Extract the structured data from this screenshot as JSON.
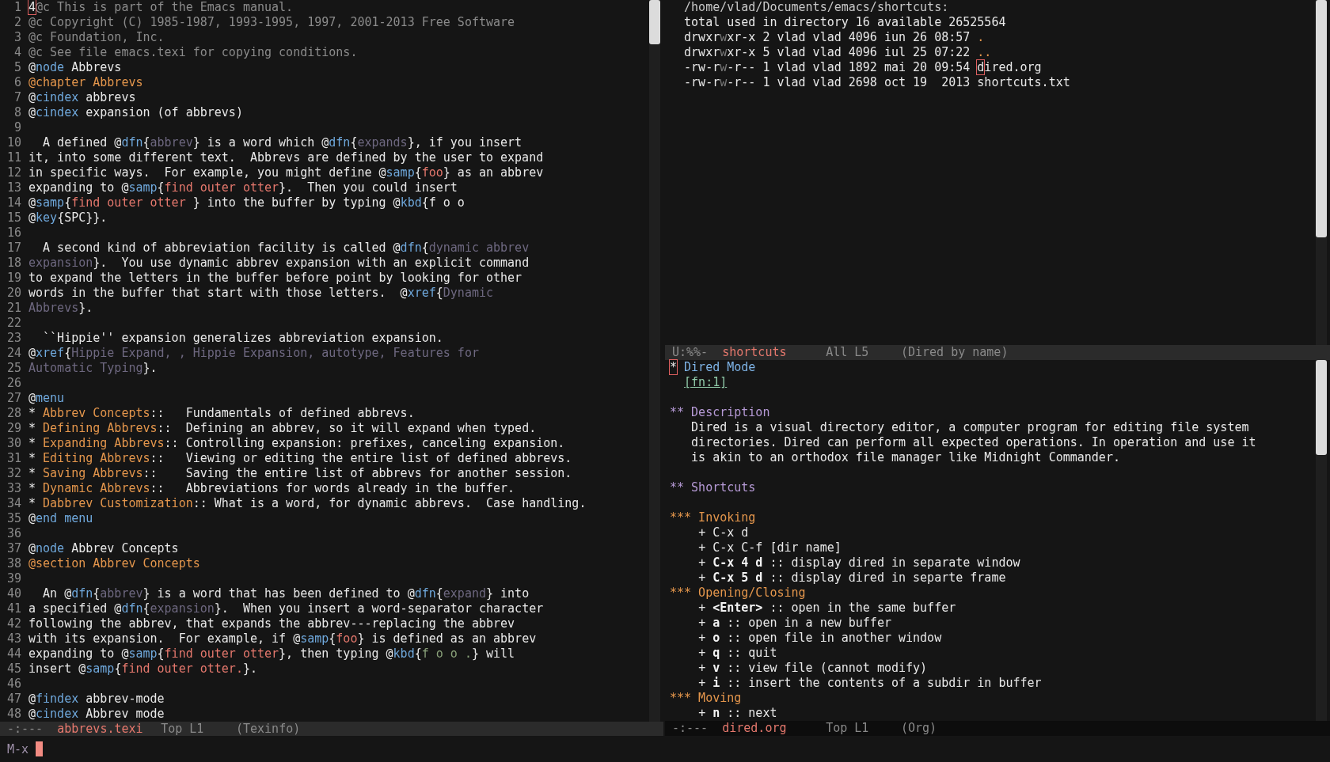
{
  "left_window": {
    "lines": [
      {
        "number": "1",
        "segments": [
          {
            "text": "4",
            "kind": "cursor"
          },
          {
            "text": "@c This is part of the Emacs manual.",
            "kind": "comment"
          }
        ]
      },
      {
        "number": "2",
        "segments": [
          {
            "text": "@c Copyright (C) 1985-1987, 1993-1995, 1997, 2001-2013 Free Software",
            "kind": "comment"
          }
        ]
      },
      {
        "number": "3",
        "segments": [
          {
            "text": "@c Foundation, Inc.",
            "kind": "comment"
          }
        ]
      },
      {
        "number": "4",
        "segments": [
          {
            "text": "@c See file emacs.texi for copying conditions.",
            "kind": "comment"
          }
        ]
      },
      {
        "number": "5",
        "segments": [
          {
            "text": "@",
            "kind": "default"
          },
          {
            "text": "node",
            "kind": "keyword"
          },
          {
            "text": " Abbrevs",
            "kind": "default"
          }
        ]
      },
      {
        "number": "6",
        "segments": [
          {
            "text": "@chapter Abbrevs",
            "kind": "heading"
          }
        ]
      },
      {
        "number": "7",
        "segments": [
          {
            "text": "@",
            "kind": "default"
          },
          {
            "text": "cindex",
            "kind": "keyword"
          },
          {
            "text": " abbrevs",
            "kind": "default"
          }
        ]
      },
      {
        "number": "8",
        "segments": [
          {
            "text": "@",
            "kind": "default"
          },
          {
            "text": "cindex",
            "kind": "keyword"
          },
          {
            "text": " expansion (of abbrevs)",
            "kind": "default"
          }
        ]
      },
      {
        "number": "9"
      },
      {
        "number": "10",
        "segments": [
          {
            "text": "  A defined @",
            "kind": "default"
          },
          {
            "text": "dfn",
            "kind": "keyword"
          },
          {
            "text": "{",
            "kind": "default"
          },
          {
            "text": "abbrev",
            "kind": "dfn"
          },
          {
            "text": "} is a word which @",
            "kind": "default"
          },
          {
            "text": "dfn",
            "kind": "keyword"
          },
          {
            "text": "{",
            "kind": "default"
          },
          {
            "text": "expands",
            "kind": "dfn"
          },
          {
            "text": "}, if you insert",
            "kind": "default"
          }
        ]
      },
      {
        "number": "11",
        "segments": [
          {
            "text": "it, into some different text.  Abbrevs are defined by the user to expand",
            "kind": "default"
          }
        ]
      },
      {
        "number": "12",
        "segments": [
          {
            "text": "in specific ways.  For example, you might define @",
            "kind": "default"
          },
          {
            "text": "samp",
            "kind": "keyword"
          },
          {
            "text": "{",
            "kind": "default"
          },
          {
            "text": "foo",
            "kind": "samp"
          },
          {
            "text": "} as an abbrev",
            "kind": "default"
          }
        ]
      },
      {
        "number": "13",
        "segments": [
          {
            "text": "expanding to @",
            "kind": "default"
          },
          {
            "text": "samp",
            "kind": "keyword"
          },
          {
            "text": "{",
            "kind": "default"
          },
          {
            "text": "find outer otter",
            "kind": "samp"
          },
          {
            "text": "}.  Then you could insert",
            "kind": "default"
          }
        ]
      },
      {
        "number": "14",
        "segments": [
          {
            "text": "@",
            "kind": "default"
          },
          {
            "text": "samp",
            "kind": "keyword"
          },
          {
            "text": "{",
            "kind": "default"
          },
          {
            "text": "find outer otter ",
            "kind": "samp"
          },
          {
            "text": "} into the buffer by typing @",
            "kind": "default"
          },
          {
            "text": "kbd",
            "kind": "keyword"
          },
          {
            "text": "{f o o",
            "kind": "default"
          }
        ]
      },
      {
        "number": "15",
        "segments": [
          {
            "text": "@",
            "kind": "default"
          },
          {
            "text": "key",
            "kind": "keyword"
          },
          {
            "text": "{SPC}}.",
            "kind": "default"
          }
        ]
      },
      {
        "number": "16"
      },
      {
        "number": "17",
        "segments": [
          {
            "text": "  A second kind of abbreviation facility is called @",
            "kind": "default"
          },
          {
            "text": "dfn",
            "kind": "keyword"
          },
          {
            "text": "{",
            "kind": "default"
          },
          {
            "text": "dynamic abbrev",
            "kind": "dfn"
          }
        ]
      },
      {
        "number": "18",
        "segments": [
          {
            "text": "expansion",
            "kind": "dfn"
          },
          {
            "text": "}.  You use dynamic abbrev expansion with an explicit command",
            "kind": "default"
          }
        ]
      },
      {
        "number": "19",
        "segments": [
          {
            "text": "to expand the letters in the buffer before point by looking for other",
            "kind": "default"
          }
        ]
      },
      {
        "number": "20",
        "segments": [
          {
            "text": "words in the buffer that start with those letters.  @",
            "kind": "default"
          },
          {
            "text": "xref",
            "kind": "keyword"
          },
          {
            "text": "{",
            "kind": "default"
          },
          {
            "text": "Dynamic",
            "kind": "dfn"
          }
        ]
      },
      {
        "number": "21",
        "segments": [
          {
            "text": "Abbrevs",
            "kind": "dfn"
          },
          {
            "text": "}.",
            "kind": "default"
          }
        ]
      },
      {
        "number": "22"
      },
      {
        "number": "23",
        "segments": [
          {
            "text": "  ``Hippie'' expansion generalizes abbreviation expansion.",
            "kind": "default"
          }
        ]
      },
      {
        "number": "24",
        "segments": [
          {
            "text": "@",
            "kind": "default"
          },
          {
            "text": "xref",
            "kind": "keyword"
          },
          {
            "text": "{",
            "kind": "default"
          },
          {
            "text": "Hippie Expand, , Hippie Expansion, autotype, Features for",
            "kind": "dfn"
          }
        ]
      },
      {
        "number": "25",
        "segments": [
          {
            "text": "Automatic Typing",
            "kind": "dfn"
          },
          {
            "text": "}.",
            "kind": "default"
          }
        ]
      },
      {
        "number": "26"
      },
      {
        "number": "27",
        "segments": [
          {
            "text": "@",
            "kind": "default"
          },
          {
            "text": "menu",
            "kind": "keyword"
          }
        ]
      },
      {
        "number": "28",
        "segments": [
          {
            "text": "* ",
            "kind": "default"
          },
          {
            "text": "Abbrev Concepts",
            "kind": "heading"
          },
          {
            "text": "::   Fundamentals of defined abbrevs.",
            "kind": "default"
          }
        ]
      },
      {
        "number": "29",
        "segments": [
          {
            "text": "* ",
            "kind": "default"
          },
          {
            "text": "Defining Abbrevs",
            "kind": "heading"
          },
          {
            "text": "::  Defining an abbrev, so it will expand when typed.",
            "kind": "default"
          }
        ]
      },
      {
        "number": "30",
        "segments": [
          {
            "text": "* ",
            "kind": "default"
          },
          {
            "text": "Expanding Abbrevs",
            "kind": "heading"
          },
          {
            "text": ":: Controlling expansion: prefixes, canceling expansion.",
            "kind": "default"
          }
        ]
      },
      {
        "number": "31",
        "segments": [
          {
            "text": "* ",
            "kind": "default"
          },
          {
            "text": "Editing Abbrevs",
            "kind": "heading"
          },
          {
            "text": "::   Viewing or editing the entire list of defined abbrevs.",
            "kind": "default"
          }
        ]
      },
      {
        "number": "32",
        "segments": [
          {
            "text": "* ",
            "kind": "default"
          },
          {
            "text": "Saving Abbrevs",
            "kind": "heading"
          },
          {
            "text": "::    Saving the entire list of abbrevs for another session.",
            "kind": "default"
          }
        ]
      },
      {
        "number": "33",
        "segments": [
          {
            "text": "* ",
            "kind": "default"
          },
          {
            "text": "Dynamic Abbrevs",
            "kind": "heading"
          },
          {
            "text": "::   Abbreviations for words already in the buffer.",
            "kind": "default"
          }
        ]
      },
      {
        "number": "34",
        "segments": [
          {
            "text": "* ",
            "kind": "default"
          },
          {
            "text": "Dabbrev Customization",
            "kind": "heading"
          },
          {
            "text": ":: What is a word, for dynamic abbrevs.  Case handling.",
            "kind": "default"
          }
        ]
      },
      {
        "number": "35",
        "segments": [
          {
            "text": "@",
            "kind": "default"
          },
          {
            "text": "end menu",
            "kind": "keyword"
          }
        ]
      },
      {
        "number": "36"
      },
      {
        "number": "37",
        "segments": [
          {
            "text": "@",
            "kind": "default"
          },
          {
            "text": "node",
            "kind": "keyword"
          },
          {
            "text": " Abbrev Concepts",
            "kind": "default"
          }
        ]
      },
      {
        "number": "38",
        "segments": [
          {
            "text": "@section Abbrev Concepts",
            "kind": "heading"
          }
        ]
      },
      {
        "number": "39"
      },
      {
        "number": "40",
        "segments": [
          {
            "text": "  An @",
            "kind": "default"
          },
          {
            "text": "dfn",
            "kind": "keyword"
          },
          {
            "text": "{",
            "kind": "default"
          },
          {
            "text": "abbrev",
            "kind": "dfn"
          },
          {
            "text": "} is a word that has been defined to @",
            "kind": "default"
          },
          {
            "text": "dfn",
            "kind": "keyword"
          },
          {
            "text": "{",
            "kind": "default"
          },
          {
            "text": "expand",
            "kind": "dfn"
          },
          {
            "text": "} into",
            "kind": "default"
          }
        ]
      },
      {
        "number": "41",
        "segments": [
          {
            "text": "a specified @",
            "kind": "default"
          },
          {
            "text": "dfn",
            "kind": "keyword"
          },
          {
            "text": "{",
            "kind": "default"
          },
          {
            "text": "expansion",
            "kind": "dfn"
          },
          {
            "text": "}.  When you insert a word-separator character",
            "kind": "default"
          }
        ]
      },
      {
        "number": "42",
        "segments": [
          {
            "text": "following the abbrev, that expands the abbrev---replacing the abbrev",
            "kind": "default"
          }
        ]
      },
      {
        "number": "43",
        "segments": [
          {
            "text": "with its expansion.  For example, if @",
            "kind": "default"
          },
          {
            "text": "samp",
            "kind": "keyword"
          },
          {
            "text": "{",
            "kind": "default"
          },
          {
            "text": "foo",
            "kind": "samp"
          },
          {
            "text": "} is defined as an abbrev",
            "kind": "default"
          }
        ]
      },
      {
        "number": "44",
        "segments": [
          {
            "text": "expanding to @",
            "kind": "default"
          },
          {
            "text": "samp",
            "kind": "keyword"
          },
          {
            "text": "{",
            "kind": "default"
          },
          {
            "text": "find outer otter",
            "kind": "samp"
          },
          {
            "text": "}, then typing @",
            "kind": "default"
          },
          {
            "text": "kbd",
            "kind": "keyword"
          },
          {
            "text": "{",
            "kind": "default"
          },
          {
            "text": "f o o .",
            "kind": "kbd"
          },
          {
            "text": "} will",
            "kind": "default"
          }
        ]
      },
      {
        "number": "45",
        "segments": [
          {
            "text": "insert @",
            "kind": "default"
          },
          {
            "text": "samp",
            "kind": "keyword"
          },
          {
            "text": "{",
            "kind": "default"
          },
          {
            "text": "find outer otter.",
            "kind": "samp"
          },
          {
            "text": "}.",
            "kind": "default"
          }
        ]
      },
      {
        "number": "46"
      },
      {
        "number": "47",
        "segments": [
          {
            "text": "@",
            "kind": "default"
          },
          {
            "text": "findex",
            "kind": "keyword"
          },
          {
            "text": " abbrev-mode",
            "kind": "default"
          }
        ]
      },
      {
        "number": "48",
        "segments": [
          {
            "text": "@",
            "kind": "default"
          },
          {
            "text": "cindex",
            "kind": "keyword"
          },
          {
            "text": " Abbrev mode",
            "kind": "default"
          }
        ]
      }
    ],
    "mode_line": {
      "status": "-:---",
      "buffer": "abbrevs.texi",
      "position": "Top L1",
      "mode": "(Texinfo)",
      "active": true
    }
  },
  "right_top_window": {
    "lines": [
      {
        "segments": [
          {
            "text": "  /home/vlad/Documents/emacs/shortcuts:",
            "kind": "header"
          }
        ]
      },
      {
        "segments": [
          {
            "text": "  total used in directory 16 available 26525564",
            "kind": "default"
          }
        ]
      },
      {
        "segments": [
          {
            "text": "  drwxr",
            "kind": "default"
          },
          {
            "text": "w",
            "kind": "dim"
          },
          {
            "text": "xr-x 2 vlad vlad 4096 iun 26 08:57 ",
            "kind": "default"
          },
          {
            "text": ".",
            "kind": "heading"
          }
        ]
      },
      {
        "segments": [
          {
            "text": "  drwxr",
            "kind": "default"
          },
          {
            "text": "w",
            "kind": "dim"
          },
          {
            "text": "xr-x 5 vlad vlad 4096 iul 25 07:22 ",
            "kind": "default"
          },
          {
            "text": "..",
            "kind": "heading"
          }
        ]
      },
      {
        "segments": [
          {
            "text": "  -rw-r",
            "kind": "default"
          },
          {
            "text": "w",
            "kind": "dim"
          },
          {
            "text": "-r-- 1 vlad vlad 1892 mai 20 09:54 ",
            "kind": "default"
          },
          {
            "text": "d",
            "kind": "cursor"
          },
          {
            "text": "ired.org",
            "kind": "default"
          }
        ]
      },
      {
        "segments": [
          {
            "text": "  -rw-r",
            "kind": "default"
          },
          {
            "text": "w",
            "kind": "dim"
          },
          {
            "text": "-r-- 1 vlad vlad 2698 oct 19  2013 shortcuts.txt",
            "kind": "default"
          }
        ]
      }
    ],
    "mode_line": {
      "status": "U:%%-",
      "buffer": "shortcuts",
      "position": "All L5",
      "mode": "(Dired by name)",
      "active": true
    }
  },
  "right_bottom_window": {
    "blocks": [
      {
        "lines": [
          {
            "segments": [
              {
                "text": "*",
                "kind": "cursor"
              },
              {
                "text": " Dired Mode",
                "kind": "title"
              }
            ]
          },
          {
            "segments": [
              {
                "text": "  [fn:1]",
                "kind": "link"
              }
            ]
          }
        ]
      },
      {
        "lines": [
          {
            "segments": [
              {
                "text": "** Description",
                "kind": "level2"
              }
            ]
          },
          {
            "segments": [
              {
                "text": "   Dired is a visual directory editor, a computer program for editing file system",
                "kind": "default"
              }
            ]
          },
          {
            "segments": [
              {
                "text": "   directories. Dired can perform all expected operations. In operation and use it",
                "kind": "default"
              }
            ]
          },
          {
            "segments": [
              {
                "text": "   is akin to an orthodox file manager like Midnight Commander.",
                "kind": "default"
              }
            ]
          }
        ]
      },
      {
        "lines": [
          {
            "segments": [
              {
                "text": "** Shortcuts",
                "kind": "level2"
              }
            ]
          }
        ]
      },
      {
        "lines": [
          {
            "segments": [
              {
                "text": "*** Invoking",
                "kind": "heading"
              }
            ]
          },
          {
            "segments": [
              {
                "text": "    + C-x d",
                "kind": "default"
              }
            ]
          },
          {
            "segments": [
              {
                "text": "    + C-x C-f [dir name]",
                "kind": "default"
              }
            ]
          },
          {
            "segments": [
              {
                "text": "    + ",
                "kind": "default"
              },
              {
                "text": "C-x 4 d",
                "kind": "bold"
              },
              {
                "text": " :: display dired in separate window",
                "kind": "default"
              }
            ]
          },
          {
            "segments": [
              {
                "text": "    + ",
                "kind": "default"
              },
              {
                "text": "C-x 5 d",
                "kind": "bold"
              },
              {
                "text": " :: display dired in separte frame",
                "kind": "default"
              }
            ]
          },
          {
            "segments": [
              {
                "text": "*** Opening/Closing",
                "kind": "heading"
              }
            ]
          },
          {
            "segments": [
              {
                "text": "    + ",
                "kind": "default"
              },
              {
                "text": "<Enter>",
                "kind": "bold"
              },
              {
                "text": " :: open in the same buffer",
                "kind": "default"
              }
            ]
          },
          {
            "segments": [
              {
                "text": "    + ",
                "kind": "default"
              },
              {
                "text": "a",
                "kind": "bold"
              },
              {
                "text": " :: open in a new buffer",
                "kind": "default"
              }
            ]
          },
          {
            "segments": [
              {
                "text": "    + ",
                "kind": "default"
              },
              {
                "text": "o",
                "kind": "bold"
              },
              {
                "text": " :: open file in another window",
                "kind": "default"
              }
            ]
          },
          {
            "segments": [
              {
                "text": "    + ",
                "kind": "default"
              },
              {
                "text": "q",
                "kind": "bold"
              },
              {
                "text": " :: quit",
                "kind": "default"
              }
            ]
          },
          {
            "segments": [
              {
                "text": "    + ",
                "kind": "default"
              },
              {
                "text": "v",
                "kind": "bold"
              },
              {
                "text": " :: view file (cannot modify)",
                "kind": "default"
              }
            ]
          },
          {
            "segments": [
              {
                "text": "    + ",
                "kind": "default"
              },
              {
                "text": "i",
                "kind": "bold"
              },
              {
                "text": " :: insert the contents of a subdir in buffer",
                "kind": "default"
              }
            ]
          },
          {
            "segments": [
              {
                "text": "*** Moving",
                "kind": "heading"
              }
            ]
          },
          {
            "segments": [
              {
                "text": "    + ",
                "kind": "default"
              },
              {
                "text": "n",
                "kind": "bold"
              },
              {
                "text": " :: next",
                "kind": "default"
              }
            ]
          }
        ]
      }
    ],
    "mode_line": {
      "status": "-:---",
      "buffer": "dired.org",
      "position": "Top L1",
      "mode": "(Org)",
      "active": false
    }
  },
  "minibuffer": {
    "prompt": "M-x"
  }
}
